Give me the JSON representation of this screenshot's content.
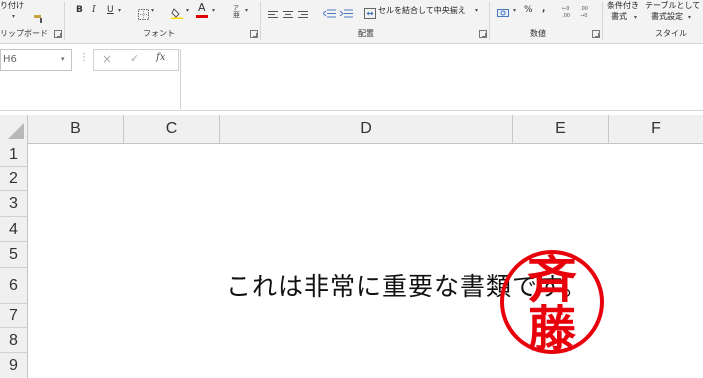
{
  "ribbon": {
    "paste_label": "り付け",
    "clipboard_group": "リップボード",
    "bold": "B",
    "italic": "I",
    "underline": "U",
    "font_group": "フォント",
    "font_color_letter": "A",
    "merge_center_label": "セルを結合して中央揃え",
    "alignment_group": "配置",
    "percent": "%",
    "comma": ",",
    "number_group": "数値",
    "cond_format_line1": "条件付き",
    "cond_format_line2": "書式",
    "table_format_line1": "テーブルとして",
    "table_format_line2": "書式設定",
    "styles_group": "スタイル",
    "colors": {
      "font_color_bar": "#e00000",
      "ribbon_bg": "#f3f3f3"
    }
  },
  "formula_bar": {
    "name_box_value": "H6",
    "cancel_symbol": "×",
    "enter_symbol": "✓",
    "fx_symbol": "fx",
    "formula_value": ""
  },
  "grid": {
    "columns": [
      "B",
      "C",
      "D",
      "E",
      "F"
    ],
    "rows": [
      "1",
      "2",
      "3",
      "4",
      "5",
      "6",
      "7",
      "8",
      "9"
    ]
  },
  "cell_content": {
    "text": "これは非常に重要な書類です。"
  },
  "seal": {
    "surname": "斉藤",
    "char1": "斉",
    "char2": "藤",
    "color": "#e8000b"
  }
}
